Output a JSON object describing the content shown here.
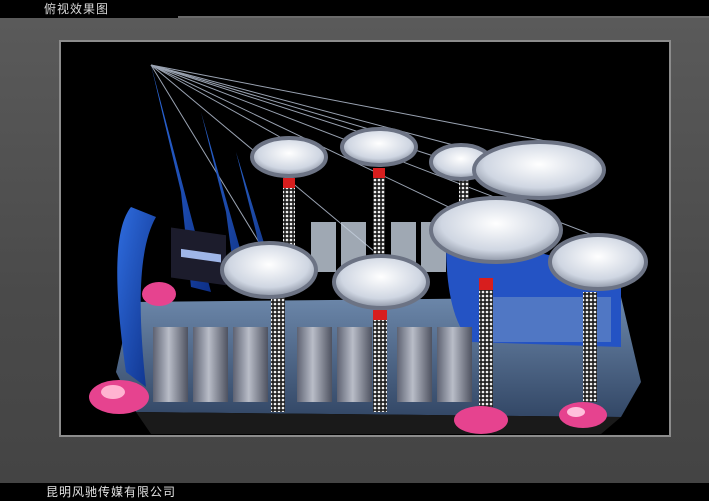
{
  "header": {
    "title": "俯视效果图"
  },
  "footer": {
    "company": "昆明风驰传媒有限公司"
  },
  "colors": {
    "frame": "#4e4e4e",
    "booth_blue": "#1f4fb8",
    "canopy_silver": "#c8cdd6",
    "column_accent": "#d81e1e",
    "flowers": "#e6438f"
  }
}
